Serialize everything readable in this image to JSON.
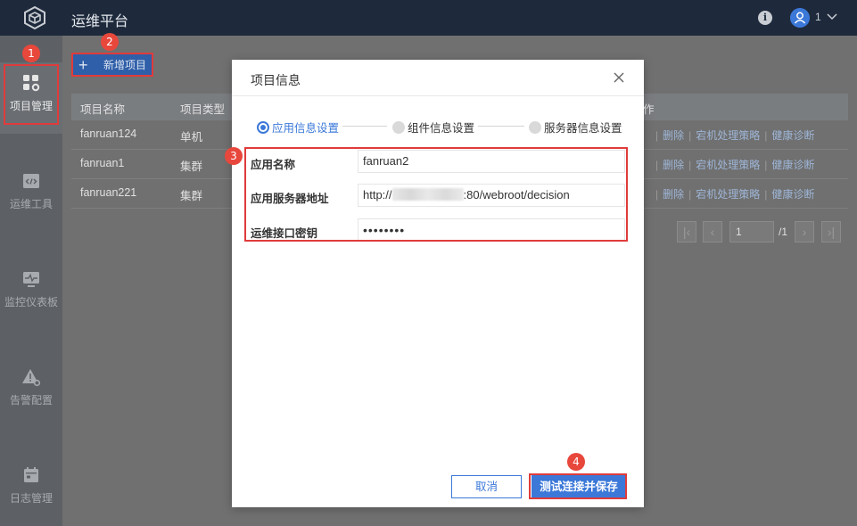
{
  "header": {
    "title": "运维平台",
    "user": "1"
  },
  "sidebar": {
    "items": [
      {
        "label": "项目管理",
        "icon": "grid-gear-icon",
        "active": true
      },
      {
        "label": "运维工具",
        "icon": "code-window-icon"
      },
      {
        "label": "监控仪表板",
        "icon": "monitor-pulse-icon"
      },
      {
        "label": "告警配置",
        "icon": "warning-gear-icon"
      },
      {
        "label": "日志管理",
        "icon": "calendar-log-icon"
      }
    ]
  },
  "main": {
    "add_button": "新增项目",
    "table": {
      "headers": [
        "项目名称",
        "项目类型",
        "作"
      ],
      "rows": [
        {
          "name": "fanruan124",
          "type": "单机"
        },
        {
          "name": "fanruan1",
          "type": "集群"
        },
        {
          "name": "fanruan221",
          "type": "集群"
        }
      ],
      "ops": [
        "删除",
        "宕机处理策略",
        "健康诊断"
      ]
    },
    "pager": {
      "page": "1",
      "total": "/1"
    }
  },
  "modal": {
    "title": "项目信息",
    "steps": [
      "应用信息设置",
      "组件信息设置",
      "服务器信息设置"
    ],
    "fields": [
      {
        "label": "应用名称",
        "value": "fanruan2"
      },
      {
        "label": "应用服务器地址",
        "value_prefix": "http://",
        "value_suffix": ":80/webroot/decision"
      },
      {
        "label": "运维接口密钥",
        "value": "••••••••"
      }
    ],
    "cancel": "取消",
    "save": "测试连接并保存"
  },
  "annotations": [
    "1",
    "2",
    "3",
    "4"
  ],
  "colors": {
    "accent": "#3b78d8",
    "highlight": "#e03b3b",
    "badge": "#e8473c",
    "topbar": "#1e2a3c"
  }
}
